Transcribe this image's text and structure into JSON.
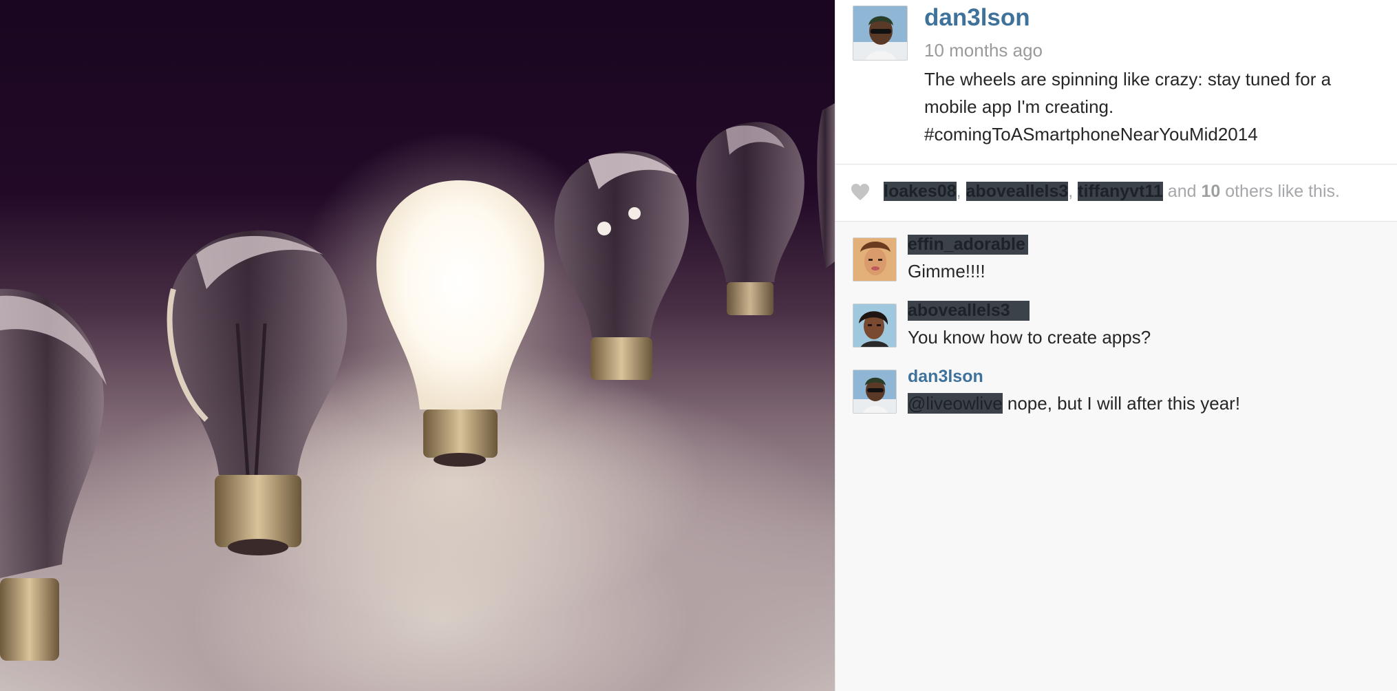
{
  "post": {
    "photo_alt": "",
    "owner": {
      "username": "dan3lson",
      "posted_ago": "10 months ago",
      "caption": "The wheels are spinning like crazy: stay tuned for a mobile app I'm creating. #comingToASmartphoneNearYouMid2014"
    },
    "likes": {
      "users": [
        "loakes08",
        "aboveallels3",
        "tiffanyvt11"
      ],
      "separator": ", ",
      "and_text": " and ",
      "others_count": "10",
      "others_text": " others like this."
    },
    "comments": [
      {
        "username": "effin_adorable",
        "text": "Gimme!!!!",
        "mention": ""
      },
      {
        "username": "aboveallels3",
        "text": "You know how to create apps?",
        "mention": ""
      },
      {
        "username": "dan3lson",
        "text": " nope, but I will after this year!",
        "mention": "@liveowlive"
      }
    ]
  },
  "colors": {
    "username_blue": "#3f729b",
    "meta_gray": "#9a9a9a",
    "text": "#262626",
    "redaction": "#3b4249"
  }
}
